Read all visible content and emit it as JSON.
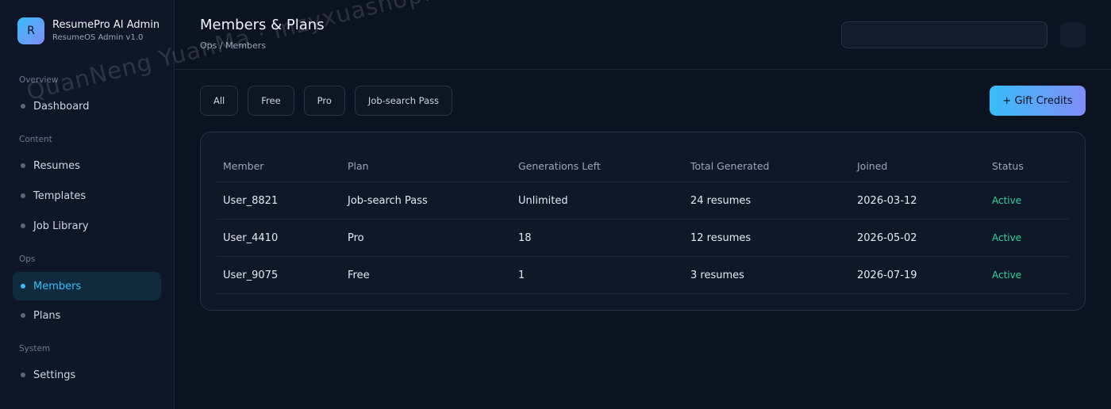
{
  "brand": {
    "logo_letter": "R",
    "name": "ResumePro AI Admin",
    "subtitle": "ResumeOS Admin v1.0"
  },
  "sidebar": {
    "sections": [
      {
        "label": "Overview",
        "items": [
          {
            "label": "Dashboard",
            "active": false
          }
        ]
      },
      {
        "label": "Content",
        "items": [
          {
            "label": "Resumes",
            "active": false
          },
          {
            "label": "Templates",
            "active": false
          },
          {
            "label": "Job Library",
            "active": false
          }
        ]
      },
      {
        "label": "Ops",
        "items": [
          {
            "label": "Members",
            "active": true
          },
          {
            "label": "Plans",
            "active": false
          }
        ]
      },
      {
        "label": "System",
        "items": [
          {
            "label": "Settings",
            "active": false
          }
        ]
      }
    ]
  },
  "header": {
    "title": "Members & Plans",
    "breadcrumb": "Ops / Members"
  },
  "filters": [
    "All",
    "Free",
    "Pro",
    "Job-search Pass"
  ],
  "actions": {
    "gift_label": "+ Gift Credits"
  },
  "table": {
    "columns": [
      "Member",
      "Plan",
      "Generations Left",
      "Total Generated",
      "Joined",
      "Status"
    ],
    "rows": [
      {
        "member": "User_8821",
        "plan": "Job-search Pass",
        "generations_left": "Unlimited",
        "total": "24 resumes",
        "joined": "2026-03-12",
        "status": "Active"
      },
      {
        "member": "User_4410",
        "plan": "Pro",
        "generations_left": "18",
        "total": "12 resumes",
        "joined": "2026-05-02",
        "status": "Active"
      },
      {
        "member": "User_9075",
        "plan": "Free",
        "generations_left": "1",
        "total": "3 resumes",
        "joined": "2026-07-19",
        "status": "Active"
      }
    ]
  },
  "watermark": "QuanNeng YuanMa · inzyxuashop.com",
  "colors": {
    "accent": "#38bdf8",
    "accent_secondary": "#818cf8",
    "status_active": "#34d399",
    "background": "#0b1220"
  }
}
